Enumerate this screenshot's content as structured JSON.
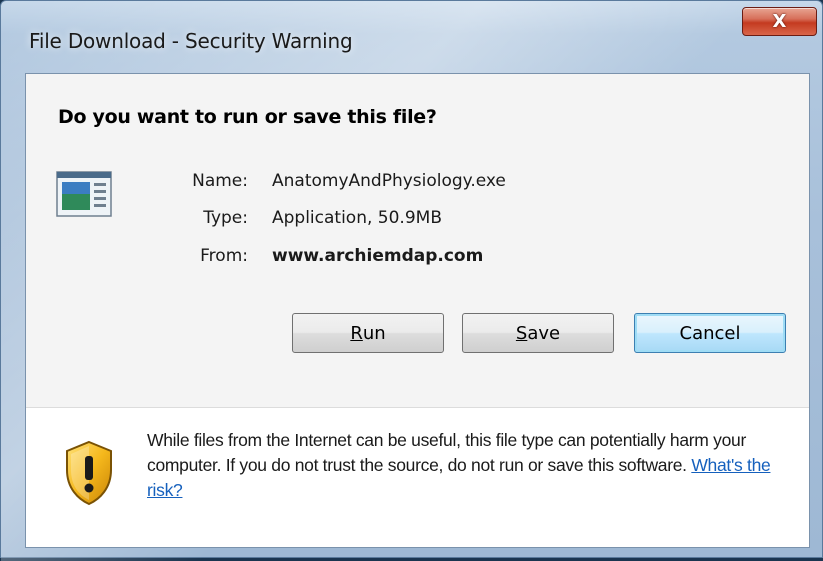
{
  "window": {
    "title": "File Download - Security Warning",
    "close_glyph": "X"
  },
  "dialog": {
    "question": "Do you want to run or save this file?",
    "file_icon": "application-window-icon",
    "fields": [
      {
        "label": "Name:",
        "value": "AnatomyAndPhysiology.exe"
      },
      {
        "label": "Type:",
        "value": "Application, 50.9MB"
      },
      {
        "label": "From:",
        "value": "www.archiemdap.com"
      }
    ],
    "buttons": {
      "run": {
        "mnemonic": "R",
        "rest": "un"
      },
      "save": {
        "mnemonic": "S",
        "rest": "ave"
      },
      "cancel": "Cancel"
    }
  },
  "warning": {
    "icon": "shield-warning-icon",
    "text": "While files from the Internet can be useful, this file type can potentially harm your computer. If you do not trust the source, do not run or save this software.",
    "link": "What's the risk?"
  },
  "colors": {
    "link": "#1560bd",
    "close_button": "#c43a20",
    "default_button_border": "#3c7fb1"
  }
}
